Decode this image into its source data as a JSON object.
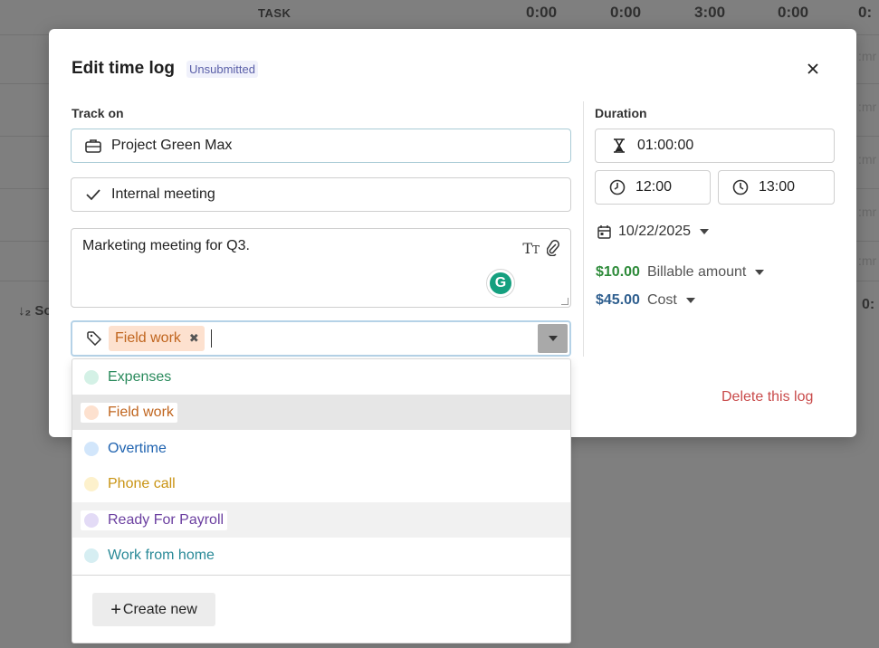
{
  "background": {
    "header": {
      "task_label": "TASK",
      "totals": [
        "0:00",
        "0:00",
        "3:00",
        "0:00",
        "0:"
      ]
    },
    "side_label": "↓₂ So",
    "right_fragments": [
      ":mr",
      ":mr",
      ":mr",
      ":mr",
      ":mr"
    ],
    "right_bottom": "0:"
  },
  "modal": {
    "title": "Edit time log",
    "status": "Unsubmitted",
    "track_on_label": "Track on",
    "project": "Project Green Max",
    "task": "Internal meeting",
    "notes": "Marketing meeting for Q3.",
    "grammarly": "G",
    "tags": {
      "selected": [
        "Field work"
      ]
    },
    "duration_label": "Duration",
    "duration": "01:00:00",
    "start_time": "12:00",
    "end_time": "13:00",
    "date": "10/22/2025",
    "billable": {
      "value": "$10.00",
      "label": "Billable amount",
      "color": "#2e8b3a"
    },
    "cost": {
      "value": "$45.00",
      "label": "Cost",
      "color": "#2f5f8f"
    },
    "delete_label": "Delete this log"
  },
  "tag_dropdown": {
    "options": [
      {
        "label": "Expenses",
        "dot": "#d4f1e6",
        "text_color": "#2a8a5c"
      },
      {
        "label": "Field work",
        "dot": "#fde1cf",
        "text_color": "#c0651e"
      },
      {
        "label": "Overtime",
        "dot": "#d2e6fb",
        "text_color": "#1f63b0"
      },
      {
        "label": "Phone call",
        "dot": "#fdf1cc",
        "text_color": "#c99414"
      },
      {
        "label": "Ready For Payroll",
        "dot": "#e3dbf6",
        "text_color": "#6b3fa0"
      },
      {
        "label": "Work from home",
        "dot": "#d6eef2",
        "text_color": "#2a8a98"
      }
    ],
    "create_label": "Create new"
  }
}
